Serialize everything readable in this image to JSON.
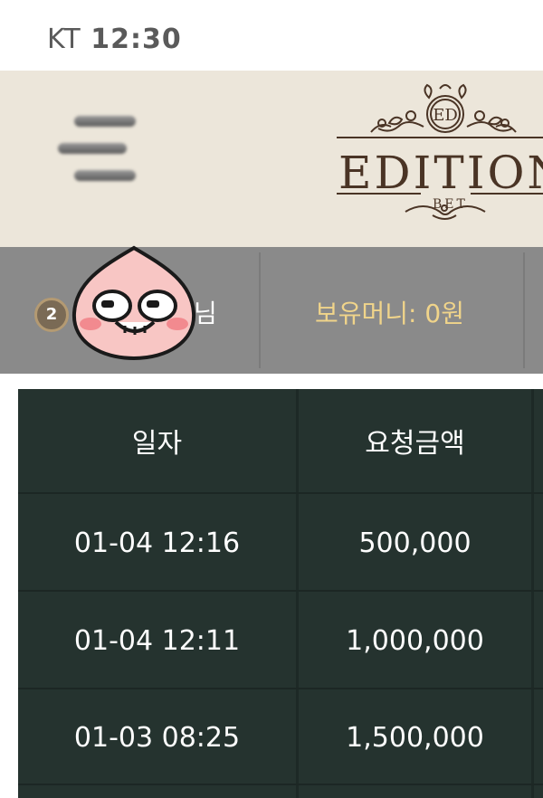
{
  "status_bar": {
    "carrier": "KT",
    "time": "12:30"
  },
  "header": {
    "menu_icon": "hamburger-menu-icon",
    "logo_monogram": "ED",
    "logo_text": "EDITION",
    "logo_subtext": "BET"
  },
  "user_bar": {
    "level": "2",
    "name_suffix": "님",
    "balance_label": "보유머니:",
    "balance_value": "0원",
    "sticker_icon": "peach-character-sticker"
  },
  "table": {
    "columns": [
      "일자",
      "요청금액"
    ],
    "rows": [
      {
        "date": "01-04 12:16",
        "amount": "500,000"
      },
      {
        "date": "01-04 12:11",
        "amount": "1,000,000"
      },
      {
        "date": "01-03 08:25",
        "amount": "1,500,000"
      }
    ]
  },
  "colors": {
    "header_bg": "#ece6da",
    "userbar_bg": "#8a8a8a",
    "table_bg": "#25332f",
    "balance_text": "#f0d48a",
    "logo_brown": "#4a3425"
  }
}
